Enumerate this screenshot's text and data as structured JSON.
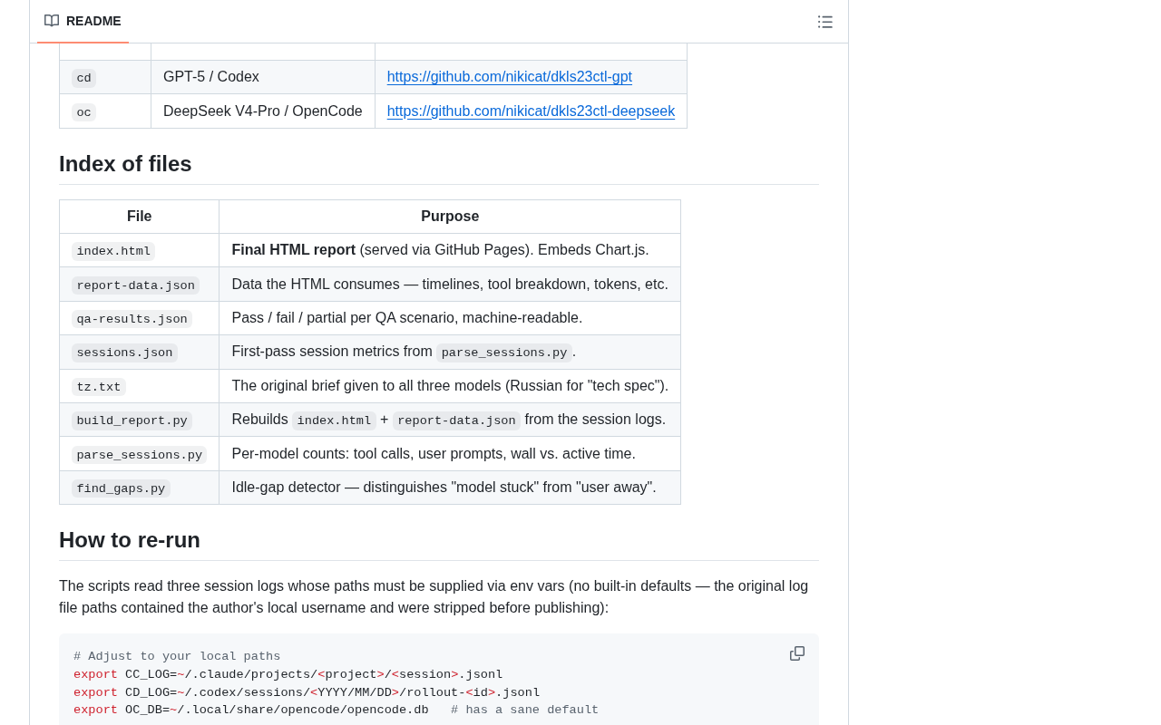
{
  "readme_header": {
    "tabs": [
      {
        "label": "README",
        "selected": true
      }
    ]
  },
  "agents_table": {
    "rows": [
      {
        "alias": "cd",
        "agent": "GPT-5 / Codex",
        "link": "https://github.com/nikicat/dkls23ctl-gpt"
      },
      {
        "alias": "oc",
        "agent": "DeepSeek V4-Pro / OpenCode",
        "link": "https://github.com/nikicat/dkls23ctl-deepseek"
      }
    ]
  },
  "index_of_files": {
    "heading": "Index of files",
    "columns": [
      "File",
      "Purpose"
    ],
    "rows": [
      {
        "file": "index.html",
        "purpose": [
          {
            "kind": "text",
            "text": "**Final HTML report** (served via GitHub Pages). Embeds Chart.js."
          }
        ]
      },
      {
        "file": "report-data.json",
        "purpose": [
          {
            "kind": "text",
            "text": "Data the HTML consumes — timelines, tool breakdown, tokens, etc."
          }
        ]
      },
      {
        "file": "qa-results.json",
        "purpose": [
          {
            "kind": "text",
            "text": "Pass / fail / partial per QA scenario, machine-readable."
          }
        ]
      },
      {
        "file": "sessions.json",
        "purpose": [
          {
            "kind": "text",
            "text": "First-pass session metrics from "
          },
          {
            "kind": "code",
            "text": "parse_sessions.py"
          },
          {
            "kind": "text",
            "text": "."
          }
        ]
      },
      {
        "file": "tz.txt",
        "purpose": [
          {
            "kind": "text",
            "text": "The original brief given to all three models (Russian for \"tech spec\")."
          }
        ]
      },
      {
        "file": "build_report.py",
        "purpose": [
          {
            "kind": "text",
            "text": "Rebuilds "
          },
          {
            "kind": "code",
            "text": "index.html"
          },
          {
            "kind": "text",
            "text": " + "
          },
          {
            "kind": "code",
            "text": "report-data.json"
          },
          {
            "kind": "text",
            "text": " from the session logs."
          }
        ]
      },
      {
        "file": "parse_sessions.py",
        "purpose": [
          {
            "kind": "text",
            "text": "Per-model counts: tool calls, user prompts, wall vs. active time."
          }
        ]
      },
      {
        "file": "find_gaps.py",
        "purpose": [
          {
            "kind": "text",
            "text": "Idle-gap detector — distinguishes \"model stuck\" from \"user away\"."
          }
        ]
      }
    ]
  },
  "how_to_rerun": {
    "heading": "How to re-run",
    "paragraph": "The scripts read three session logs whose paths must be supplied via env vars (no built-in defaults — the original log file paths contained the author's local username and were stripped before publishing):",
    "code_block": {
      "lines": [
        {
          "tokens": [
            {
              "kind": "comment",
              "text": "# Adjust to your local paths"
            }
          ]
        },
        {
          "tokens": [
            {
              "kind": "keyword",
              "text": "export"
            },
            {
              "kind": "plain",
              "text": " CC_LOG="
            },
            {
              "kind": "operator",
              "text": "~"
            },
            {
              "kind": "plain",
              "text": "/.claude/projects/"
            },
            {
              "kind": "operator",
              "text": "<"
            },
            {
              "kind": "plain",
              "text": "project"
            },
            {
              "kind": "operator",
              "text": ">"
            },
            {
              "kind": "plain",
              "text": "/"
            },
            {
              "kind": "operator",
              "text": "<"
            },
            {
              "kind": "plain",
              "text": "session"
            },
            {
              "kind": "operator",
              "text": ">"
            },
            {
              "kind": "plain",
              "text": ".jsonl"
            }
          ]
        },
        {
          "tokens": [
            {
              "kind": "keyword",
              "text": "export"
            },
            {
              "kind": "plain",
              "text": " CD_LOG="
            },
            {
              "kind": "operator",
              "text": "~"
            },
            {
              "kind": "plain",
              "text": "/.codex/sessions/"
            },
            {
              "kind": "operator",
              "text": "<"
            },
            {
              "kind": "plain",
              "text": "YYYY/MM/DD"
            },
            {
              "kind": "operator",
              "text": ">"
            },
            {
              "kind": "plain",
              "text": "/rollout-"
            },
            {
              "kind": "operator",
              "text": "<"
            },
            {
              "kind": "plain",
              "text": "id"
            },
            {
              "kind": "operator",
              "text": ">"
            },
            {
              "kind": "plain",
              "text": ".jsonl"
            }
          ]
        },
        {
          "tokens": [
            {
              "kind": "keyword",
              "text": "export"
            },
            {
              "kind": "plain",
              "text": " OC_DB="
            },
            {
              "kind": "operator",
              "text": "~"
            },
            {
              "kind": "plain",
              "text": "/.local/share/opencode/opencode.db   "
            },
            {
              "kind": "comment",
              "text": "# has a sane default"
            }
          ]
        }
      ]
    }
  }
}
